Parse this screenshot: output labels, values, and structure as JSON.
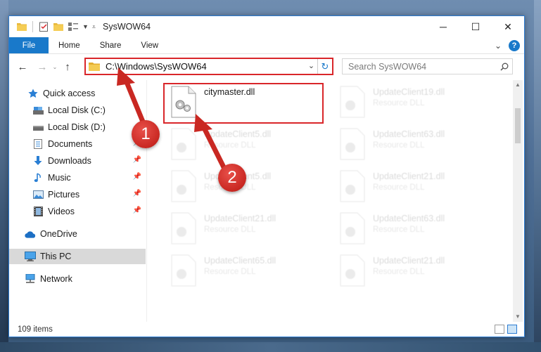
{
  "window": {
    "title": "SysWOW64",
    "controls": {
      "minimize": "─",
      "maximize": "☐",
      "close": "✕"
    }
  },
  "ribbon": {
    "tabs": [
      "File",
      "Home",
      "Share",
      "View"
    ],
    "expand": "⌄",
    "help": "?"
  },
  "nav_buttons": {
    "back": "←",
    "forward": "→",
    "recent": "⌄",
    "up": "↑"
  },
  "address": {
    "path": "C:\\Windows\\SysWOW64",
    "dropdown": "⌄",
    "refresh": "↻"
  },
  "search": {
    "placeholder": "Search SysWOW64"
  },
  "sidebar": {
    "items": [
      {
        "label": "Quick access",
        "icon": "star-icon"
      },
      {
        "label": "Local Disk (C:)",
        "icon": "drive-icon",
        "pinned": true
      },
      {
        "label": "Local Disk (D:)",
        "icon": "drive-icon",
        "pinned": true
      },
      {
        "label": "Documents",
        "icon": "documents-icon",
        "pinned": true
      },
      {
        "label": "Downloads",
        "icon": "download-icon",
        "pinned": true
      },
      {
        "label": "Music",
        "icon": "music-icon",
        "pinned": true
      },
      {
        "label": "Pictures",
        "icon": "pictures-icon",
        "pinned": true
      },
      {
        "label": "Videos",
        "icon": "videos-icon",
        "pinned": true
      },
      {
        "label": "OneDrive",
        "icon": "cloud-icon"
      },
      {
        "label": "This PC",
        "icon": "computer-icon",
        "selected": true
      },
      {
        "label": "Network",
        "icon": "network-icon"
      }
    ],
    "pin_glyph": "📌"
  },
  "files": {
    "highlighted": {
      "name": "citymaster.dll",
      "type": ""
    },
    "tiles": [
      {
        "name": "UpdateClient19.dll",
        "type": "Resource DLL"
      },
      {
        "name": "UpdateClient5.dll",
        "type": "Resource DLL"
      },
      {
        "name": "UpdateClient63.dll",
        "type": "Resource DLL"
      },
      {
        "name": "UpdateClient5.dll",
        "type": "Resource DLL"
      },
      {
        "name": "UpdateClient21.dll",
        "type": "Resource DLL"
      },
      {
        "name": "UpdateClient21.dll",
        "type": "Resource DLL"
      },
      {
        "name": "UpdateClient63.dll",
        "type": "Resource DLL"
      },
      {
        "name": "UpdateClient65.dll",
        "type": "Resource DLL"
      },
      {
        "name": "UpdateClient21.dll",
        "type": "Resource DLL"
      }
    ]
  },
  "status": {
    "item_count": "109 items"
  },
  "annotations": {
    "step1": "1",
    "step2": "2"
  },
  "colors": {
    "accent": "#1979ca",
    "highlight_red": "#d9262a",
    "marker_red": "#c92822"
  }
}
